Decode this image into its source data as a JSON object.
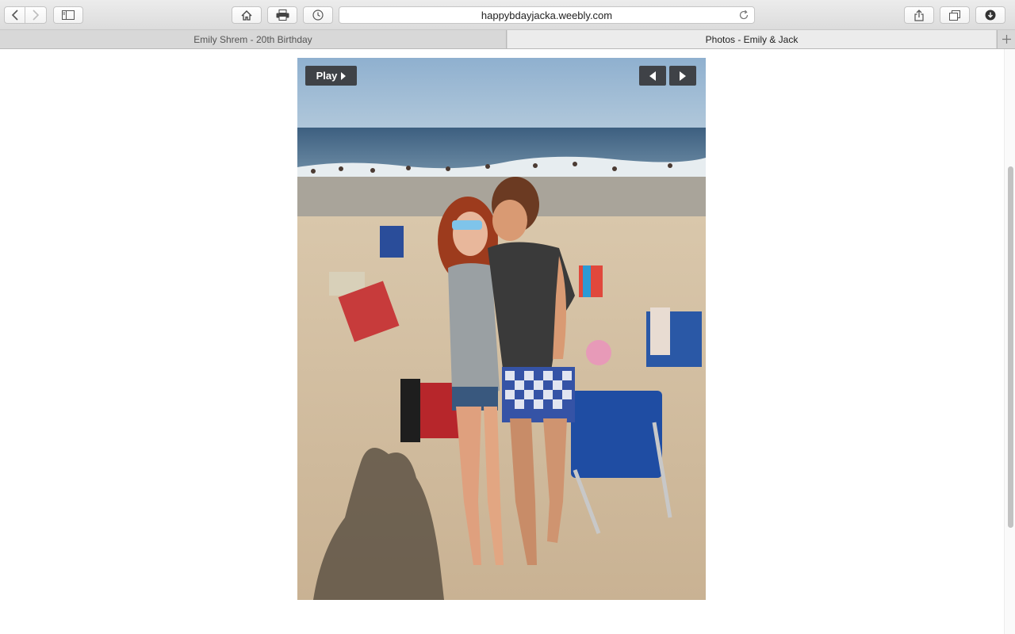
{
  "browser": {
    "url": "happybdayjacka.weebly.com",
    "tabs": [
      {
        "label": "Emily Shrem - 20th Birthday",
        "active": false
      },
      {
        "label": "Photos - Emily & Jack",
        "active": true
      }
    ],
    "toolbar_icons": [
      "back-icon",
      "forward-icon",
      "sidebar-icon",
      "home-icon",
      "print-icon",
      "history-icon",
      "reload-icon",
      "share-icon",
      "tabs-overview-icon",
      "downloads-icon"
    ]
  },
  "slideshow": {
    "play_label": "Play",
    "photo_description_icon": "beach-photo",
    "controls": [
      "prev-arrow-icon",
      "next-arrow-icon"
    ]
  },
  "colors": {
    "control_bg": "#3f4247",
    "toolbar_bg": "#e6e6e6"
  }
}
